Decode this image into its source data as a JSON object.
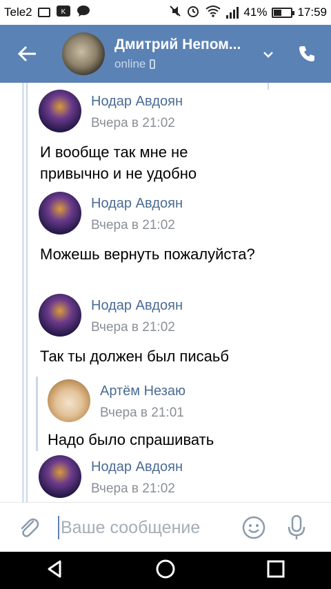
{
  "status_bar": {
    "carrier": "Tele2",
    "battery_percent": "41%",
    "battery_level": 0.41,
    "time": "17:59"
  },
  "header": {
    "contact_name": "Дмитрий Непом...",
    "status": "online"
  },
  "messages": [
    {
      "sender": "Нодар Авдоян",
      "time": "Вчера в 21:02",
      "text": "И вообще так мне не привычно и не удобно"
    },
    {
      "sender": "Нодар Авдоян",
      "time": "Вчера в 21:02",
      "text": "Можешь вернуть пожалуйста?"
    },
    {
      "sender": "Нодар Авдоян",
      "time": "Вчера в 21:02",
      "text": "Так ты должен был писаьб"
    },
    {
      "sender": "Артём Незаю",
      "time": "Вчера в 21:01",
      "text": "Надо было спрашивать"
    },
    {
      "sender": "Нодар Авдоян",
      "time": "Вчера в 21:02",
      "text": ""
    }
  ],
  "composer": {
    "placeholder": "Ваше сообщение",
    "value": ""
  },
  "colors": {
    "header_bg": "#5b82b5",
    "sender_name": "#4a6b94",
    "timestamp": "#8a8f96"
  }
}
